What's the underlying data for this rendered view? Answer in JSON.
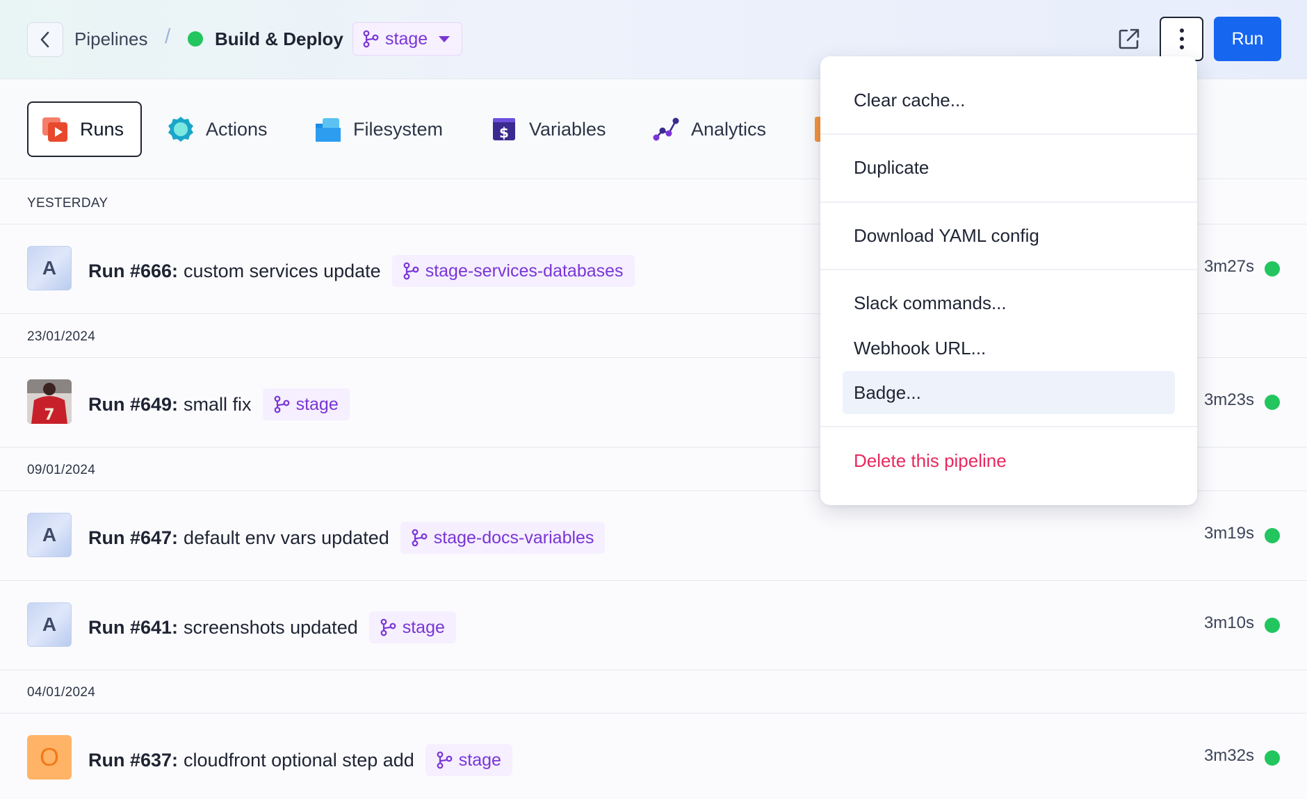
{
  "header": {
    "breadcrumb_root": "Pipelines",
    "separator": "/",
    "pipeline_name": "Build & Deploy",
    "branch": "stage",
    "run_label": "Run"
  },
  "tabs": [
    {
      "label": "Runs",
      "icon": "runs-icon"
    },
    {
      "label": "Actions",
      "icon": "actions-icon"
    },
    {
      "label": "Filesystem",
      "icon": "filesystem-icon"
    },
    {
      "label": "Variables",
      "icon": "variables-icon"
    },
    {
      "label": "Analytics",
      "icon": "analytics-icon"
    }
  ],
  "sections": [
    {
      "label": "YESTERDAY"
    },
    {
      "label": "23/01/2024"
    },
    {
      "label": "09/01/2024"
    },
    {
      "label": "04/01/2024"
    }
  ],
  "runs": [
    {
      "avatar": "A",
      "number": "Run #666:",
      "title": "custom services update",
      "branch": "stage-services-databases",
      "duration": "3m27s"
    },
    {
      "avatar": "",
      "number": "Run #649:",
      "title": "small fix",
      "branch": "stage",
      "duration": "3m23s"
    },
    {
      "avatar": "A",
      "number": "Run #647:",
      "title": "default env vars updated",
      "branch": "stage-docs-variables",
      "duration": "3m19s"
    },
    {
      "avatar": "A",
      "number": "Run #641:",
      "title": "screenshots updated",
      "branch": "stage",
      "duration": "3m10s"
    },
    {
      "avatar": "O",
      "number": "Run #637:",
      "title": "cloudfront optional step add",
      "branch": "stage",
      "duration": "3m32s"
    }
  ],
  "menu": {
    "items": [
      {
        "label": "Clear cache..."
      },
      {
        "label": "Duplicate"
      },
      {
        "label": "Download YAML config"
      },
      {
        "label": "Slack commands..."
      },
      {
        "label": "Webhook URL..."
      },
      {
        "label": "Badge..."
      },
      {
        "label": "Delete this pipeline"
      }
    ]
  },
  "colors": {
    "accent": "#1766f0",
    "branch": "#7a35d6",
    "success": "#22c55e",
    "danger": "#e8285f"
  }
}
